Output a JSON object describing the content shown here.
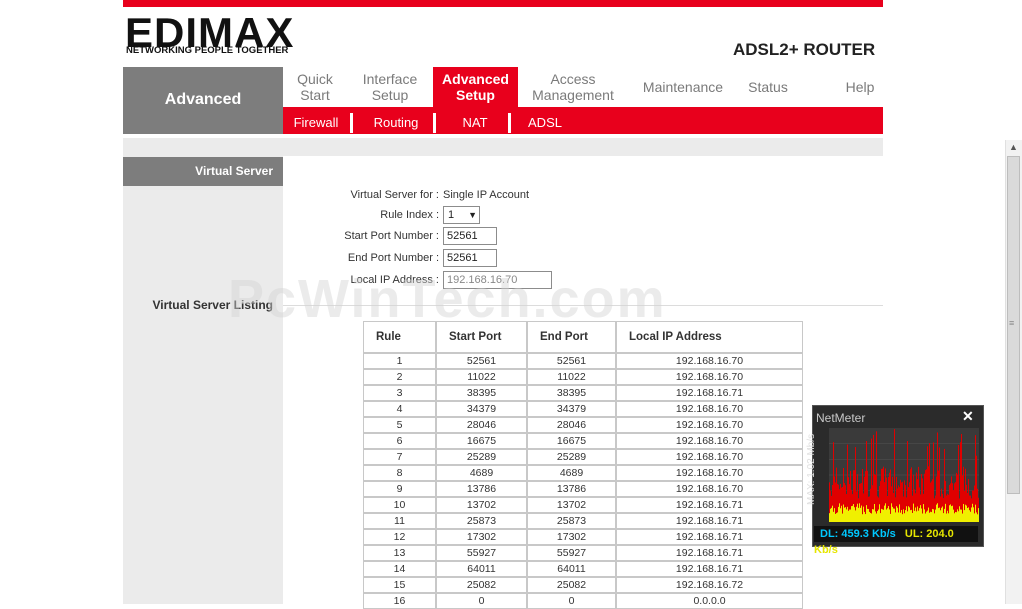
{
  "brand": {
    "logo_text": "EDIMAX",
    "tagline": "NETWORKING PEOPLE TOGETHER",
    "product": "ADSL2+ ROUTER",
    "color": "#e8001c"
  },
  "side": {
    "section": "Advanced",
    "virtual_server_heading": "Virtual Server",
    "listing_label": "Virtual Server Listing"
  },
  "nav": [
    {
      "line1": "Quick",
      "line2": "Start"
    },
    {
      "line1": "Interface",
      "line2": "Setup"
    },
    {
      "line1": "Advanced",
      "line2": "Setup"
    },
    {
      "line1": "Access",
      "line2": "Management"
    },
    {
      "line1": "Maintenance",
      "line2": ""
    },
    {
      "line1": "Status",
      "line2": ""
    },
    {
      "line1": "Help",
      "line2": ""
    }
  ],
  "subnav": [
    "Firewall",
    "Routing",
    "NAT",
    "ADSL"
  ],
  "form": {
    "vs_for_label": "Virtual Server for :",
    "vs_for_value": "Single IP Account",
    "rule_index_label": "Rule Index :",
    "rule_index_value": "1",
    "start_port_label": "Start Port Number :",
    "start_port_value": "52561",
    "end_port_label": "End Port Number :",
    "end_port_value": "52561",
    "local_ip_label": "Local IP Address :",
    "local_ip_value": "192.168.16.70"
  },
  "table": {
    "headers": [
      "Rule",
      "Start Port",
      "End Port",
      "Local IP Address"
    ],
    "rows": [
      [
        "1",
        "52561",
        "52561",
        "192.168.16.70"
      ],
      [
        "2",
        "11022",
        "11022",
        "192.168.16.70"
      ],
      [
        "3",
        "38395",
        "38395",
        "192.168.16.71"
      ],
      [
        "4",
        "34379",
        "34379",
        "192.168.16.70"
      ],
      [
        "5",
        "28046",
        "28046",
        "192.168.16.70"
      ],
      [
        "6",
        "16675",
        "16675",
        "192.168.16.70"
      ],
      [
        "7",
        "25289",
        "25289",
        "192.168.16.70"
      ],
      [
        "8",
        "4689",
        "4689",
        "192.168.16.70"
      ],
      [
        "9",
        "13786",
        "13786",
        "192.168.16.70"
      ],
      [
        "10",
        "13702",
        "13702",
        "192.168.16.71"
      ],
      [
        "11",
        "25873",
        "25873",
        "192.168.16.71"
      ],
      [
        "12",
        "17302",
        "17302",
        "192.168.16.71"
      ],
      [
        "13",
        "55927",
        "55927",
        "192.168.16.71"
      ],
      [
        "14",
        "64011",
        "64011",
        "192.168.16.71"
      ],
      [
        "15",
        "25082",
        "25082",
        "192.168.16.72"
      ],
      [
        "16",
        "0",
        "0",
        "0.0.0.0"
      ]
    ]
  },
  "watermark": "PcWinTech.com",
  "netmeter": {
    "title": "NetMeter",
    "close": "✕",
    "ylabel": "MAX: 1.02 Mb/s",
    "dl": "DL: 459.3 Kb/s",
    "ul": "UL: 204.0 Kb/s",
    "dl_color": "#00c8ff",
    "ul_color": "#e6e600"
  }
}
